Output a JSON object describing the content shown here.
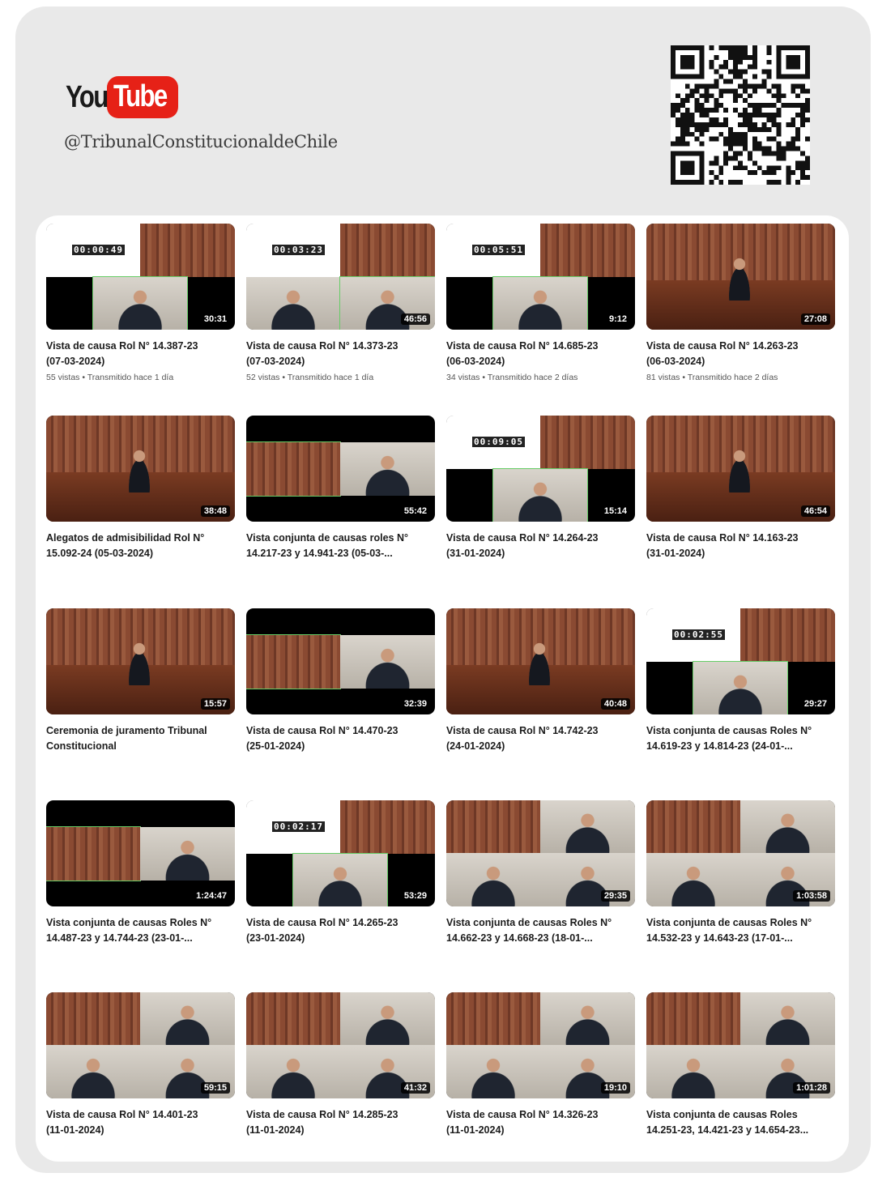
{
  "header": {
    "logo_you": "You",
    "logo_tube": "Tube",
    "handle": "@TribunalConstitucionaldeChile"
  },
  "colors": {
    "youtube_red": "#e62117",
    "background": "#e9e9e9"
  },
  "icons": {
    "qr": "qr-code-icon"
  },
  "videos": [
    {
      "title": "Vista de causa Rol N° 14.387-23\n(07-03-2024)",
      "meta": "55 vistas • Transmitido hace 1 día",
      "duration": "30:31",
      "timer": "00:00:49",
      "layout": "timer"
    },
    {
      "title": "Vista de causa Rol N° 14.373-23\n(07-03-2024)",
      "meta": "52 vistas • Transmitido hace 1 día",
      "duration": "46:56",
      "timer": "00:03:23",
      "layout": "timer2"
    },
    {
      "title": "Vista de causa Rol N° 14.685-23\n(06-03-2024)",
      "meta": "34 vistas • Transmitido hace 2 días",
      "duration": "9:12",
      "timer": "00:05:51",
      "layout": "timer"
    },
    {
      "title": "Vista de causa Rol N° 14.263-23\n(06-03-2024)",
      "meta": "81 vistas • Transmitido hace 2 días",
      "duration": "27:08",
      "timer": "",
      "layout": "room"
    },
    {
      "title": "Alegatos de admisibilidad Rol N°\n15.092-24 (05-03-2024)",
      "meta": "",
      "duration": "38:48",
      "timer": "",
      "layout": "room"
    },
    {
      "title": "Vista conjunta de causas roles N°\n14.217-23 y 14.941-23 (05-03-...",
      "meta": "",
      "duration": "55:42",
      "timer": "",
      "layout": "split"
    },
    {
      "title": "Vista de causa Rol N° 14.264-23\n(31-01-2024)",
      "meta": "",
      "duration": "15:14",
      "timer": "00:09:05",
      "layout": "timer"
    },
    {
      "title": "Vista de causa Rol N° 14.163-23\n(31-01-2024)",
      "meta": "",
      "duration": "46:54",
      "timer": "",
      "layout": "room"
    },
    {
      "title": "Ceremonia de juramento Tribunal\nConstitucional",
      "meta": "",
      "duration": "15:57",
      "timer": "",
      "layout": "room"
    },
    {
      "title": "Vista de causa Rol N° 14.470-23\n(25-01-2024)",
      "meta": "",
      "duration": "32:39",
      "timer": "",
      "layout": "split"
    },
    {
      "title": "Vista de causa Rol N° 14.742-23\n(24-01-2024)",
      "meta": "",
      "duration": "40:48",
      "timer": "",
      "layout": "room"
    },
    {
      "title": "Vista conjunta de causas Roles N°\n14.619-23 y 14.814-23 (24-01-...",
      "meta": "",
      "duration": "29:27",
      "timer": "00:02:55",
      "layout": "timer"
    },
    {
      "title": "Vista conjunta de causas Roles N°\n14.487-23 y 14.744-23 (23-01-...",
      "meta": "",
      "duration": "1:24:47",
      "timer": "",
      "layout": "split"
    },
    {
      "title": "Vista de causa Rol N° 14.265-23\n(23-01-2024)",
      "meta": "",
      "duration": "53:29",
      "timer": "00:02:17",
      "layout": "timer"
    },
    {
      "title": "Vista conjunta de causas Roles N°\n14.662-23 y 14.668-23 (18-01-...",
      "meta": "",
      "duration": "29:35",
      "timer": "",
      "layout": "grid"
    },
    {
      "title": "Vista conjunta de causas Roles N°\n14.532-23 y 14.643-23 (17-01-...",
      "meta": "",
      "duration": "1:03:58",
      "timer": "",
      "layout": "grid"
    },
    {
      "title": "Vista de causa Rol N° 14.401-23\n(11-01-2024)",
      "meta": "",
      "duration": "59:15",
      "timer": "",
      "layout": "grid"
    },
    {
      "title": "Vista de causa Rol N° 14.285-23\n(11-01-2024)",
      "meta": "",
      "duration": "41:32",
      "timer": "",
      "layout": "grid"
    },
    {
      "title": "Vista de causa Rol N° 14.326-23\n(11-01-2024)",
      "meta": "",
      "duration": "19:10",
      "timer": "",
      "layout": "grid"
    },
    {
      "title": "Vista conjunta de causas Roles\n14.251-23, 14.421-23 y 14.654-23...",
      "meta": "",
      "duration": "1:01:28",
      "timer": "",
      "layout": "grid"
    }
  ]
}
